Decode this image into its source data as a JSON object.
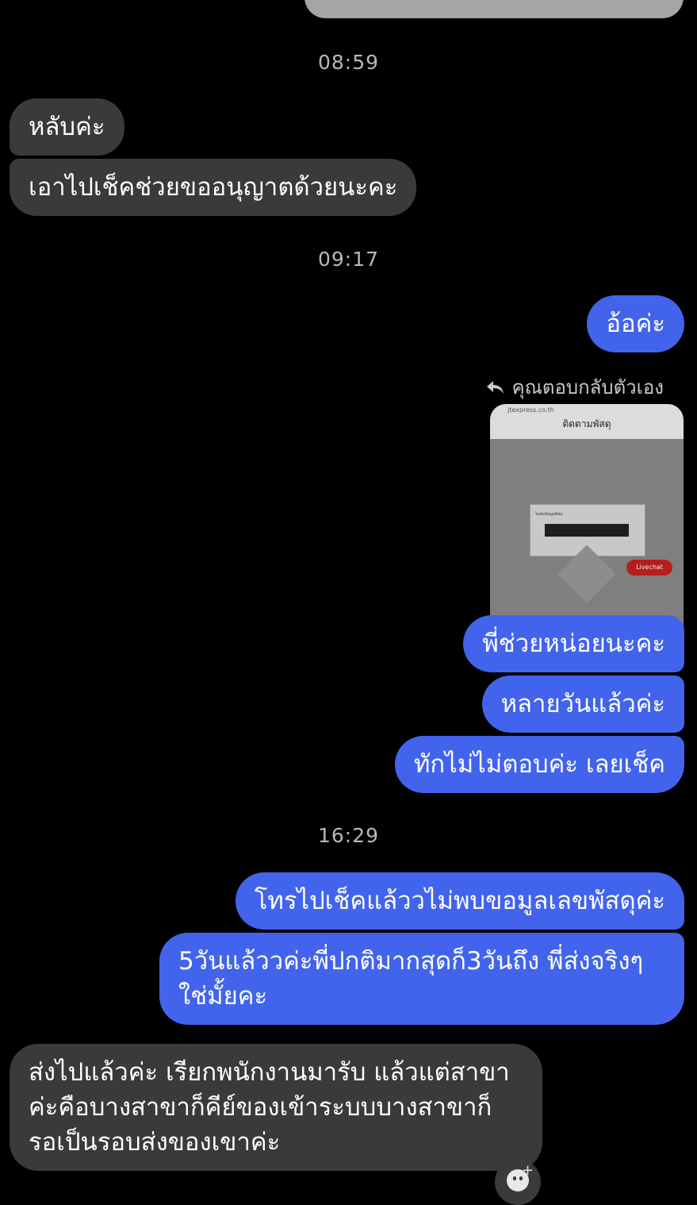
{
  "times": [
    "08:59",
    "09:17",
    "16:29"
  ],
  "messages": {
    "m1": "หลับค่ะ",
    "m2": "เอาไปเช็คช่วยขออนุญาตด้วยนะคะ",
    "m3": "อ้อค่ะ",
    "reply_label": "คุณตอบกลับตัวเอง",
    "m4": "พี่ช่วยหน่อยนะคะ",
    "m5": "หลายวันแล้วค่ะ",
    "m6": "ทักไม่ไม่ตอบค่ะ เลยเช็ค",
    "m7": "โทรไปเช็คแล้ววไม่พบขอมูลเลขพัสดุค่ะ",
    "m8": "5วันแล้ววค่ะพี่ปกติมากสุดก็3วันถึง พี่ส่งจริงๆ\nใช่มั้ยคะ",
    "m9": "ส่งไปแล้วค่ะ เรียกพนักงานมารับ แล้วแต่สาขา\nค่ะคือบางสาขาก็คีย์ของเข้าระบบบางสาขาก็\nรอเป็นรอบส่งของเขาค่ะ"
  },
  "screenshot": {
    "url": "jtexpress.co.th",
    "title": "ติดตามพัสดุ",
    "dialog_text": "ไม่พบข้อมูลพัสดุ",
    "livechat": "Livechat"
  },
  "icons": {
    "reply": "reply-arrow-icon",
    "emoji": "emoji-add-icon"
  },
  "colors": {
    "sent": "#4264ec",
    "received": "#3a3a3c",
    "background": "#000000"
  }
}
